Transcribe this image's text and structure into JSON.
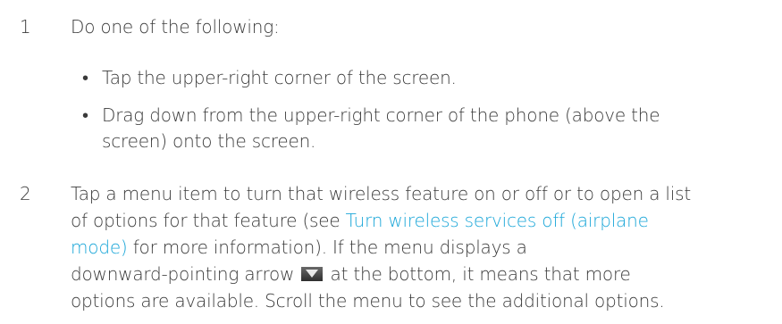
{
  "step1": {
    "number": "1",
    "intro": "Do one of the following:",
    "bullets": [
      {
        "marker": "•",
        "lines": [
          "Tap the upper-right corner of the screen."
        ]
      },
      {
        "marker": "•",
        "lines": [
          "Drag down from the upper-right corner of the phone (above the",
          "screen) onto the screen."
        ]
      }
    ]
  },
  "step2": {
    "number": "2",
    "line1": "Tap a menu item to turn that wireless feature on or off or to open a list",
    "line2": "of options for that feature (see ",
    "link_part1": "Turn wireless services off (airplane",
    "link_part2": "mode)",
    "line3_after": " for more information). If the menu displays a",
    "line4_before": "downward-pointing arrow ",
    "line4_after": " at the bottom, it means that more",
    "line5": "options are available. Scroll the menu to see the additional options.",
    "arrow_icon": "downward-arrow-icon",
    "link_color": "#1aa6d8"
  }
}
